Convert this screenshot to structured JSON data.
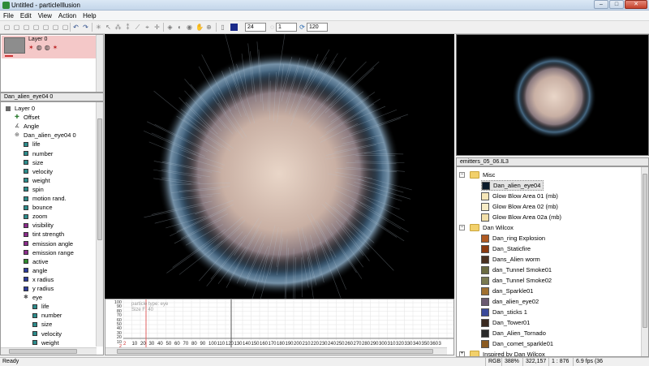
{
  "window": {
    "title": "Untitled - particleIllusion",
    "minimize": "–",
    "maximize": "□",
    "close": "✕"
  },
  "menu": [
    "File",
    "Edit",
    "View",
    "Action",
    "Help"
  ],
  "toolbar": {
    "frame": "24",
    "step": "1",
    "total": "120"
  },
  "layers": {
    "items": [
      {
        "name": "Layer 0"
      }
    ]
  },
  "tree": {
    "header": "Dan_alien_eye04 0",
    "items": [
      {
        "label": "Layer 0",
        "color": "#4a4a4a",
        "indent": 0,
        "kind": "root"
      },
      {
        "label": "Offset",
        "color": "#2e7d32",
        "indent": 1,
        "kind": "plus"
      },
      {
        "label": "Angle",
        "color": "#555555",
        "indent": 1,
        "kind": "angle"
      },
      {
        "label": "Dan_alien_eye04 0",
        "color": "#555555",
        "indent": 1,
        "kind": "emitter"
      },
      {
        "label": "life",
        "color": "#2c8c8c",
        "indent": 2
      },
      {
        "label": "number",
        "color": "#2c8c8c",
        "indent": 2
      },
      {
        "label": "size",
        "color": "#2c8c8c",
        "indent": 2
      },
      {
        "label": "velocity",
        "color": "#2c8c8c",
        "indent": 2
      },
      {
        "label": "weight",
        "color": "#2c8c8c",
        "indent": 2
      },
      {
        "label": "spin",
        "color": "#2c8c8c",
        "indent": 2
      },
      {
        "label": "motion rand.",
        "color": "#2c8c8c",
        "indent": 2
      },
      {
        "label": "bounce",
        "color": "#2c8c8c",
        "indent": 2
      },
      {
        "label": "zoom",
        "color": "#2c8c8c",
        "indent": 2
      },
      {
        "label": "visibility",
        "color": "#8c2c8c",
        "indent": 2
      },
      {
        "label": "tint strength",
        "color": "#8c2c8c",
        "indent": 2
      },
      {
        "label": "emission angle",
        "color": "#8c2c8c",
        "indent": 2
      },
      {
        "label": "emission range",
        "color": "#8c2c8c",
        "indent": 2
      },
      {
        "label": "active",
        "color": "#2e8b2e",
        "indent": 2
      },
      {
        "label": "angle",
        "color": "#2c3c9c",
        "indent": 2
      },
      {
        "label": "x radius",
        "color": "#2c3c9c",
        "indent": 2
      },
      {
        "label": "y radius",
        "color": "#2c3c9c",
        "indent": 2
      },
      {
        "label": "eye",
        "color": "#555555",
        "indent": 2,
        "kind": "particle"
      },
      {
        "label": "life",
        "color": "#2c8c8c",
        "indent": 3
      },
      {
        "label": "number",
        "color": "#2c8c8c",
        "indent": 3
      },
      {
        "label": "size",
        "color": "#2c8c8c",
        "indent": 3
      },
      {
        "label": "velocity",
        "color": "#2c8c8c",
        "indent": 3
      },
      {
        "label": "weight",
        "color": "#2c8c8c",
        "indent": 3
      }
    ]
  },
  "timeline": {
    "overlay_line1": "particle type: eye",
    "overlay_line2": "Size  F: 40",
    "y_labels": [
      "100",
      "90",
      "80",
      "70",
      "60",
      "50",
      "40",
      "30",
      "20",
      "10",
      "2"
    ],
    "x_labels": [
      "2",
      "10",
      "20",
      "30",
      "40",
      "50",
      "60",
      "70",
      "80",
      "90",
      "100",
      "110",
      "120",
      "130",
      "140",
      "150",
      "160",
      "170",
      "180",
      "190",
      "200",
      "210",
      "220",
      "230",
      "240",
      "250",
      "260",
      "270",
      "280",
      "290",
      "300",
      "310",
      "320",
      "330",
      "340",
      "350",
      "360",
      "3"
    ]
  },
  "library": {
    "header": "emitters_05_06.IL3",
    "items": [
      {
        "label": "Misc",
        "kind": "folder",
        "indent": 0
      },
      {
        "label": "Dan_alien_eye04",
        "kind": "emitter",
        "indent": 1,
        "selected": true,
        "thumb": "#0a1a2a"
      },
      {
        "label": "Glow Blow Area 01 (mb)",
        "kind": "emitter",
        "indent": 1,
        "thumb": "#f5e6b8"
      },
      {
        "label": "Glow Blow Area 02 (mb)",
        "kind": "emitter",
        "indent": 1,
        "thumb": "#f7ecc6"
      },
      {
        "label": "Glow Blow Area 02a (mb)",
        "kind": "emitter",
        "indent": 1,
        "thumb": "#f2dfa8"
      },
      {
        "label": "Dan Wilcox",
        "kind": "folder",
        "indent": 0
      },
      {
        "label": "Dan_ring Explosion",
        "kind": "emitter",
        "indent": 1,
        "thumb": "#b05a22"
      },
      {
        "label": "Dan_Staticfire",
        "kind": "emitter",
        "indent": 1,
        "thumb": "#8a3a10"
      },
      {
        "label": "Dans_Alien worm",
        "kind": "emitter",
        "indent": 1,
        "thumb": "#4a3020"
      },
      {
        "label": "dan_Tunnel Smoke01",
        "kind": "emitter",
        "indent": 1,
        "thumb": "#6a6a40"
      },
      {
        "label": "dan_Tunnel Smoke02",
        "kind": "emitter",
        "indent": 1,
        "thumb": "#7a7a50"
      },
      {
        "label": "dan_Sparkle01",
        "kind": "emitter",
        "indent": 1,
        "thumb": "#a07030"
      },
      {
        "label": "dan_alien_eye02",
        "kind": "emitter",
        "indent": 1,
        "thumb": "#6a5a70"
      },
      {
        "label": "Dan_sticks 1",
        "kind": "emitter",
        "indent": 1,
        "thumb": "#3a4a9a"
      },
      {
        "label": "Dan_Tower01",
        "kind": "emitter",
        "indent": 1,
        "thumb": "#3a2a20"
      },
      {
        "label": "Dan_Alien_Tornado",
        "kind": "emitter",
        "indent": 1,
        "thumb": "#2a2a2a"
      },
      {
        "label": "Dan_comet_sparkle01",
        "kind": "emitter",
        "indent": 1,
        "thumb": "#8a5a20"
      },
      {
        "label": "Inspired by Dan Wilcox",
        "kind": "folder",
        "indent": 0
      }
    ]
  },
  "status": {
    "ready": "Ready",
    "mode": "RGB",
    "zoom": "388%",
    "coords": "322,157",
    "ratio": "1 : 876",
    "fps": "6.9 fps (36"
  }
}
